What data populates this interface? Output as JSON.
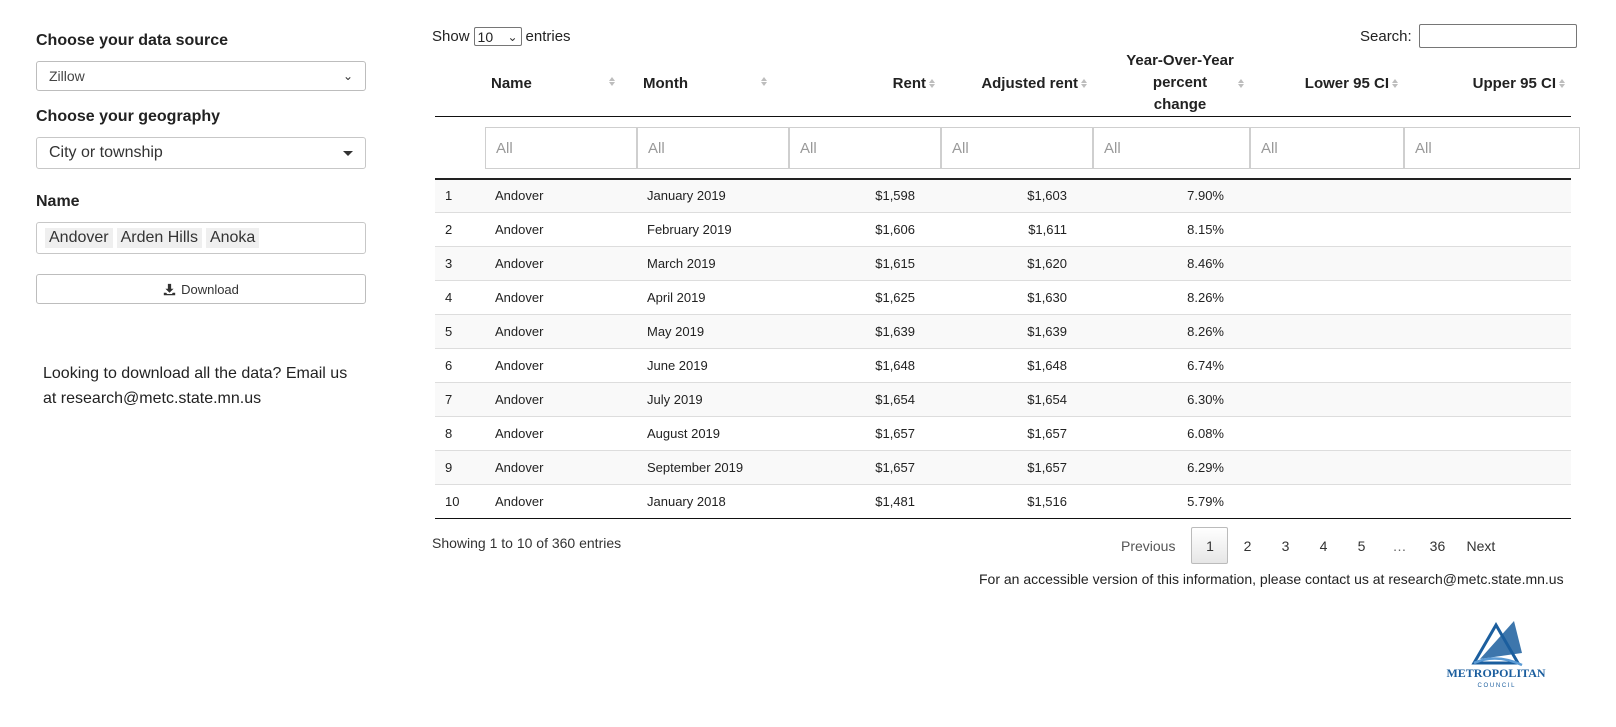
{
  "sidebar": {
    "data_source": {
      "label": "Choose your data source",
      "value": "Zillow"
    },
    "geography": {
      "label": "Choose your geography",
      "value": "City or township"
    },
    "name": {
      "label": "Name",
      "tags": [
        "Andover",
        "Arden Hills",
        "Anoka"
      ]
    },
    "download_label": "Download",
    "note": "Looking to download all the data? Email us at research@metc.state.mn.us"
  },
  "table_controls": {
    "show": "Show",
    "length": "10",
    "entries": "entries",
    "search_label": "Search:"
  },
  "table": {
    "columns": [
      "Name",
      "Month",
      "Rent",
      "Adjusted rent",
      "Year-Over-Year percent change",
      "Lower 95 CI",
      "Upper 95 CI"
    ],
    "filter_placeholder": "All",
    "rows": [
      [
        "1",
        "Andover",
        "January 2019",
        "$1,598",
        "$1,603",
        "7.90%",
        "",
        ""
      ],
      [
        "2",
        "Andover",
        "February 2019",
        "$1,606",
        "$1,611",
        "8.15%",
        "",
        ""
      ],
      [
        "3",
        "Andover",
        "March 2019",
        "$1,615",
        "$1,620",
        "8.46%",
        "",
        ""
      ],
      [
        "4",
        "Andover",
        "April 2019",
        "$1,625",
        "$1,630",
        "8.26%",
        "",
        ""
      ],
      [
        "5",
        "Andover",
        "May 2019",
        "$1,639",
        "$1,639",
        "8.26%",
        "",
        ""
      ],
      [
        "6",
        "Andover",
        "June 2019",
        "$1,648",
        "$1,648",
        "6.74%",
        "",
        ""
      ],
      [
        "7",
        "Andover",
        "July 2019",
        "$1,654",
        "$1,654",
        "6.30%",
        "",
        ""
      ],
      [
        "8",
        "Andover",
        "August 2019",
        "$1,657",
        "$1,657",
        "6.08%",
        "",
        ""
      ],
      [
        "9",
        "Andover",
        "September 2019",
        "$1,657",
        "$1,657",
        "6.29%",
        "",
        ""
      ],
      [
        "10",
        "Andover",
        "January 2018",
        "$1,481",
        "$1,516",
        "5.79%",
        "",
        ""
      ]
    ]
  },
  "pagination": {
    "info": "Showing 1 to 10 of 360 entries",
    "previous": "Previous",
    "pages": [
      "1",
      "2",
      "3",
      "4",
      "5",
      "…",
      "36"
    ],
    "current": "1",
    "next": "Next"
  },
  "footer": {
    "accessible": "For an accessible version of this information, please contact us at research@metc.state.mn.us",
    "logo_text": "METROPOLITAN",
    "logo_sub": "C O U N C I L"
  },
  "colors": {
    "logo_blue": "#1b5e9e"
  }
}
